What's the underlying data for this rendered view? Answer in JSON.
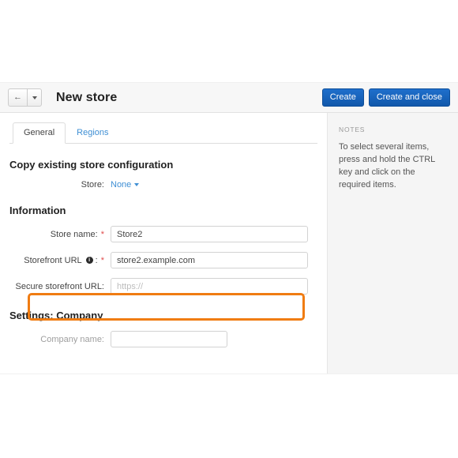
{
  "header": {
    "back_icon": "back-arrow-icon",
    "caret_icon": "chevron-down-icon",
    "title": "New store",
    "create_label": "Create",
    "create_and_close_label": "Create and close"
  },
  "tabs": [
    {
      "label": "General",
      "active": true
    },
    {
      "label": "Regions",
      "active": false
    }
  ],
  "notes": {
    "title": "NOTES",
    "text": "To select several items, press and hold the CTRL key and click on the required items."
  },
  "sections": {
    "copy_config": {
      "title": "Copy existing store configuration",
      "store_label": "Store:",
      "store_value": "None",
      "store_caret_icon": "chevron-down-icon"
    },
    "information": {
      "title": "Information",
      "store_name_label": "Store name:",
      "store_name_required": "*",
      "store_name_value": "Store2",
      "storefront_url_label": "Storefront URL",
      "storefront_url_info_icon": "info-icon",
      "storefront_url_info_glyph": "i",
      "storefront_url_colon": ":",
      "storefront_url_required": "*",
      "storefront_url_value": "store2.example.com",
      "secure_url_label": "Secure storefront URL:",
      "secure_url_value": "",
      "secure_url_placeholder": "https://"
    },
    "settings_company": {
      "title": "Settings: Company",
      "company_name_label": "Company name:",
      "company_name_value": ""
    }
  },
  "colors": {
    "accent_blue": "#3f8fd4",
    "button_blue": "#1566c0",
    "highlight_orange": "#f07c12",
    "required_red": "#e04b4b"
  }
}
